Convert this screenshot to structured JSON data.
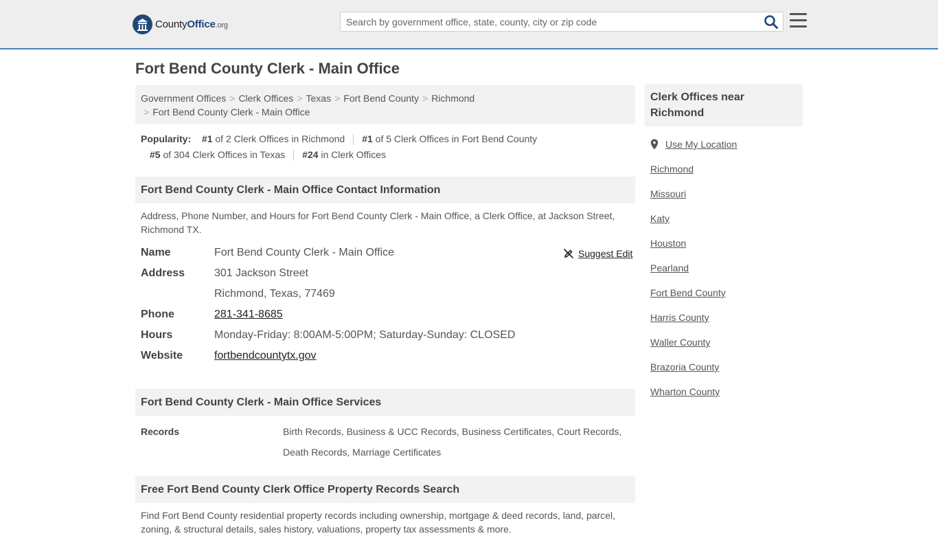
{
  "header": {
    "logo": {
      "brand_strong": "County",
      "brand_mid": "Office",
      "brand_tld": ".org"
    },
    "search_placeholder": "Search by government office, state, county, city or zip code",
    "search_icon": "search-icon",
    "menu_icon": "hamburger-menu-icon",
    "accent_color": "#4a7fc1",
    "brand_color": "#21487a"
  },
  "page_title": "Fort Bend County Clerk - Main Office",
  "breadcrumb": [
    "Government Offices",
    "Clerk Offices",
    "Texas",
    "Fort Bend County",
    "Richmond",
    "Fort Bend County Clerk - Main Office"
  ],
  "popularity": {
    "label": "Popularity:",
    "items": [
      {
        "rank": "#1",
        "text": " of 2 Clerk Offices in Richmond"
      },
      {
        "rank": "#1",
        "text": " of 5 Clerk Offices in Fort Bend County"
      },
      {
        "rank": "#5",
        "text": " of 304 Clerk Offices in Texas"
      },
      {
        "rank": "#24",
        "text": " in Clerk Offices"
      }
    ]
  },
  "contact": {
    "heading": "Fort Bend County Clerk - Main Office Contact Information",
    "description": "Address, Phone Number, and Hours for Fort Bend County Clerk - Main Office, a Clerk Office, at Jackson Street, Richmond TX.",
    "suggest_edit": "Suggest Edit",
    "labels": {
      "name": "Name",
      "address": "Address",
      "phone": "Phone",
      "hours": "Hours",
      "website": "Website"
    },
    "name": "Fort Bend County Clerk - Main Office",
    "address_line1": "301 Jackson Street",
    "address_line2": "Richmond, Texas, 77469",
    "phone": "281-341-8685",
    "hours": "Monday-Friday: 8:00AM-5:00PM; Saturday-Sunday: CLOSED",
    "website": "fortbendcountytx.gov"
  },
  "services": {
    "heading": "Fort Bend County Clerk - Main Office Services",
    "label": "Records",
    "value": "Birth Records, Business & UCC Records, Business Certificates, Court Records, Death Records, Marriage Certificates"
  },
  "property": {
    "heading": "Free Fort Bend County Clerk Office Property Records Search",
    "description": "Find Fort Bend County residential property records including ownership, mortgage & deed records, land, parcel, zoning, & structural details, sales history, valuations, property tax assessments & more."
  },
  "sidebar": {
    "heading": "Clerk Offices near Richmond",
    "use_location": "Use My Location",
    "links": [
      "Richmond",
      "Missouri",
      "Katy",
      "Houston",
      "Pearland",
      "Fort Bend County",
      "Harris County",
      "Waller County",
      "Brazoria County",
      "Wharton County"
    ]
  }
}
